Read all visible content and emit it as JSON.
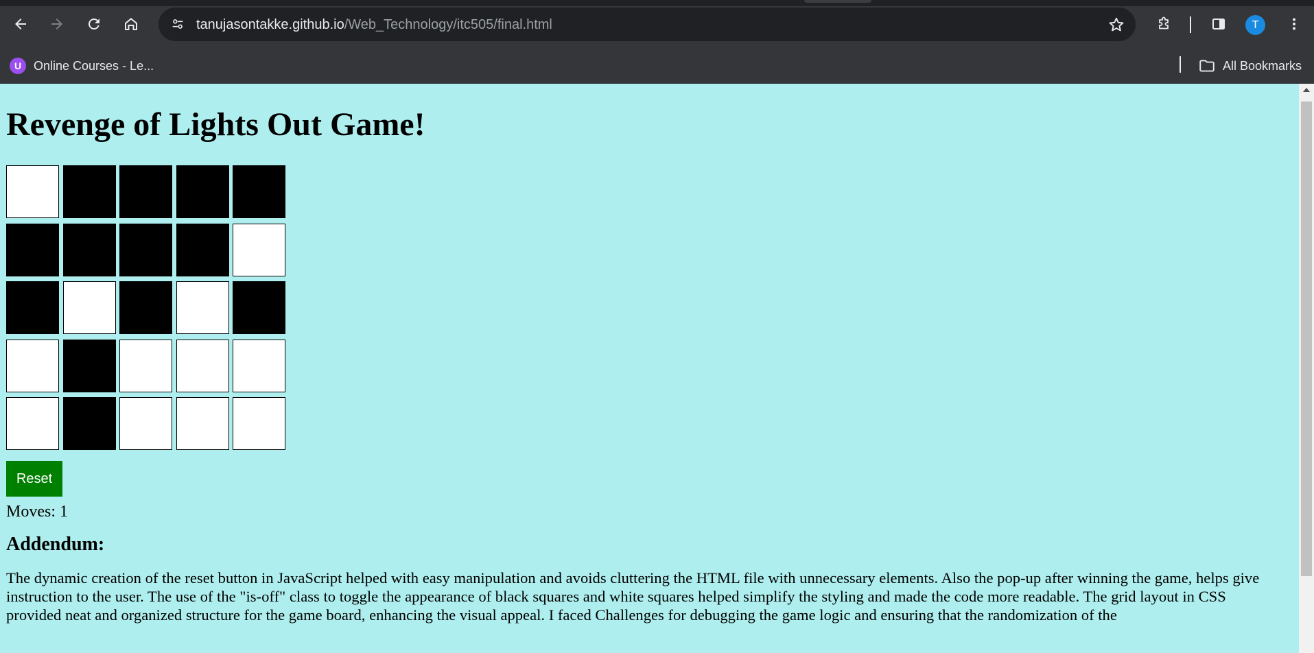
{
  "browser": {
    "url_host": "tanujasontakke.github.io",
    "url_path": "/Web_Technology/itc505/final.html",
    "profile_initial": "T",
    "bookmarks": [
      {
        "label": "Online Courses - Le...",
        "favicon_letter": "U"
      },
      {
        "label": "All Bookmarks"
      }
    ]
  },
  "page": {
    "title": "Revenge of Lights Out Game!",
    "background_color": "#afeeee",
    "board": {
      "rows": 5,
      "cols": 5,
      "cells": [
        [
          "on",
          "off",
          "off",
          "off",
          "off"
        ],
        [
          "off",
          "off",
          "off",
          "off",
          "on"
        ],
        [
          "off",
          "on",
          "off",
          "on",
          "off"
        ],
        [
          "on",
          "off",
          "on",
          "on",
          "on"
        ],
        [
          "on",
          "off",
          "on",
          "on",
          "on"
        ]
      ]
    },
    "reset_label": "Reset",
    "moves_label": "Moves:",
    "moves_value": "1",
    "addendum_heading": "Addendum:",
    "addendum_text": "The dynamic creation of the reset button in JavaScript helped with easy manipulation and avoids cluttering the HTML file with unnecessary elements. Also the pop-up after winning the game, helps give instruction to the user. The use of the \"is-off\" class to toggle the appearance of black squares and white squares helped simplify the styling and made the code more readable. The grid layout in CSS provided neat and organized structure for the game board, enhancing the visual appeal. I faced Challenges for debugging the game logic and ensuring that the randomization of the"
  }
}
